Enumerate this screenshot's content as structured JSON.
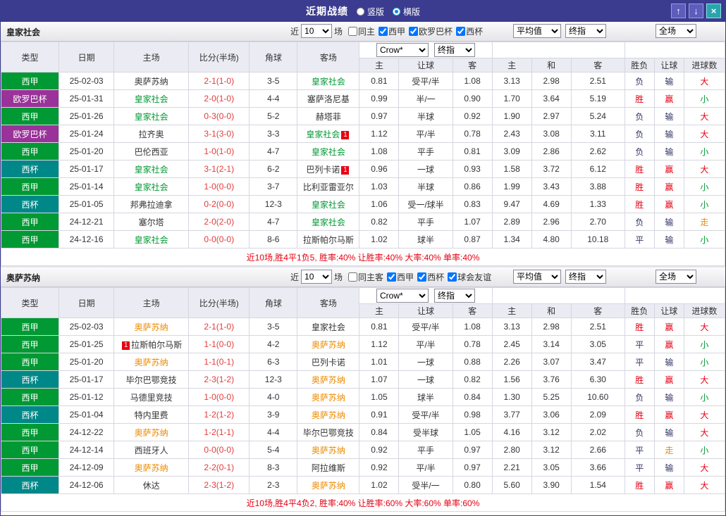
{
  "titlebar": {
    "title": "近期战绩",
    "radios": [
      {
        "label": "竖版",
        "selected": false
      },
      {
        "label": "横版",
        "selected": true
      }
    ],
    "up_icon": "↑",
    "down_icon": "↓",
    "close_icon": "×"
  },
  "columns": {
    "type": "类型",
    "date": "日期",
    "home": "主场",
    "score": "比分(半场)",
    "corner": "角球",
    "away": "客场",
    "asian": [
      "主",
      "让球",
      "客"
    ],
    "euro": [
      "主",
      "和",
      "客"
    ],
    "results": [
      "胜负",
      "让球",
      "进球数"
    ]
  },
  "filter_labels": {
    "near": "近",
    "games": "场"
  },
  "colors": {
    "league": {
      "西甲": "#009933",
      "欧罗巴杯": "#993399",
      "西杯": "#008888"
    },
    "outcome": {
      "胜": "#e60012",
      "负": "#333366",
      "平": "#333366",
      "赢": "#e60012",
      "输": "#333366",
      "走": "#e78c0a",
      "大": "#e60012",
      "小": "#009933"
    },
    "score": "#e33b3b",
    "badge": "#e60012"
  },
  "sections": [
    {
      "team": "皇家社会",
      "team_color": "#009933",
      "count": "10",
      "same_label": "同主",
      "leagues": [
        "西甲",
        "欧罗巴杯",
        "西杯"
      ],
      "selects": {
        "company": "Crow*",
        "final": "终指",
        "avg": "平均值",
        "avg_final": "终指",
        "scope": "全场"
      },
      "rows": [
        {
          "lg": "西甲",
          "date": "25-02-03",
          "home": "奥萨苏纳",
          "hh": false,
          "hb": "",
          "score": "2-1(1-0)",
          "cor": "3-5",
          "away": "皇家社会",
          "ah": true,
          "ab": "",
          "o1": "0.81",
          "hc": "受平/半",
          "o2": "1.08",
          "e1": "3.13",
          "e2": "2.98",
          "e3": "2.51",
          "r": "负",
          "hr": "输",
          "g": "大"
        },
        {
          "lg": "欧罗巴杯",
          "date": "25-01-31",
          "home": "皇家社会",
          "hh": true,
          "hb": "",
          "score": "2-0(1-0)",
          "cor": "4-4",
          "away": "塞萨洛尼基",
          "ah": false,
          "ab": "",
          "o1": "0.99",
          "hc": "半/一",
          "o2": "0.90",
          "e1": "1.70",
          "e2": "3.64",
          "e3": "5.19",
          "r": "胜",
          "hr": "赢",
          "g": "小"
        },
        {
          "lg": "西甲",
          "date": "25-01-26",
          "home": "皇家社会",
          "hh": true,
          "hb": "",
          "score": "0-3(0-0)",
          "cor": "5-2",
          "away": "赫塔菲",
          "ah": false,
          "ab": "",
          "o1": "0.97",
          "hc": "半球",
          "o2": "0.92",
          "e1": "1.90",
          "e2": "2.97",
          "e3": "5.24",
          "r": "负",
          "hr": "输",
          "g": "大"
        },
        {
          "lg": "欧罗巴杯",
          "date": "25-01-24",
          "home": "拉齐奥",
          "hh": false,
          "hb": "",
          "score": "3-1(3-0)",
          "cor": "3-3",
          "away": "皇家社会",
          "ah": true,
          "ab": "after",
          "o1": "1.12",
          "hc": "平/半",
          "o2": "0.78",
          "e1": "2.43",
          "e2": "3.08",
          "e3": "3.11",
          "r": "负",
          "hr": "输",
          "g": "大"
        },
        {
          "lg": "西甲",
          "date": "25-01-20",
          "home": "巴伦西亚",
          "hh": false,
          "hb": "",
          "score": "1-0(1-0)",
          "cor": "4-7",
          "away": "皇家社会",
          "ah": true,
          "ab": "",
          "o1": "1.08",
          "hc": "平手",
          "o2": "0.81",
          "e1": "3.09",
          "e2": "2.86",
          "e3": "2.62",
          "r": "负",
          "hr": "输",
          "g": "小"
        },
        {
          "lg": "西杯",
          "date": "25-01-17",
          "home": "皇家社会",
          "hh": true,
          "hb": "",
          "score": "3-1(2-1)",
          "cor": "6-2",
          "away": "巴列卡诺",
          "ah": false,
          "ab": "after",
          "o1": "0.96",
          "hc": "一球",
          "o2": "0.93",
          "e1": "1.58",
          "e2": "3.72",
          "e3": "6.12",
          "r": "胜",
          "hr": "赢",
          "g": "大"
        },
        {
          "lg": "西甲",
          "date": "25-01-14",
          "home": "皇家社会",
          "hh": true,
          "hb": "",
          "score": "1-0(0-0)",
          "cor": "3-7",
          "away": "比利亚雷亚尔",
          "ah": false,
          "ab": "",
          "o1": "1.03",
          "hc": "半球",
          "o2": "0.86",
          "e1": "1.99",
          "e2": "3.43",
          "e3": "3.88",
          "r": "胜",
          "hr": "赢",
          "g": "小"
        },
        {
          "lg": "西杯",
          "date": "25-01-05",
          "home": "邦弗拉迪拿",
          "hh": false,
          "hb": "",
          "score": "0-2(0-0)",
          "cor": "12-3",
          "away": "皇家社会",
          "ah": true,
          "ab": "",
          "o1": "1.06",
          "hc": "受一/球半",
          "o2": "0.83",
          "e1": "9.47",
          "e2": "4.69",
          "e3": "1.33",
          "r": "胜",
          "hr": "赢",
          "g": "小"
        },
        {
          "lg": "西甲",
          "date": "24-12-21",
          "home": "塞尔塔",
          "hh": false,
          "hb": "",
          "score": "2-0(2-0)",
          "cor": "4-7",
          "away": "皇家社会",
          "ah": true,
          "ab": "",
          "o1": "0.82",
          "hc": "平手",
          "o2": "1.07",
          "e1": "2.89",
          "e2": "2.96",
          "e3": "2.70",
          "r": "负",
          "hr": "输",
          "g": "走"
        },
        {
          "lg": "西甲",
          "date": "24-12-16",
          "home": "皇家社会",
          "hh": true,
          "hb": "",
          "score": "0-0(0-0)",
          "cor": "8-6",
          "away": "拉斯帕尔马斯",
          "ah": false,
          "ab": "",
          "o1": "1.02",
          "hc": "球半",
          "o2": "0.87",
          "e1": "1.34",
          "e2": "4.80",
          "e3": "10.18",
          "r": "平",
          "hr": "输",
          "g": "小"
        }
      ],
      "summary": "近10场,胜4平1负5, 胜率:40% 让胜率:40% 大率:40% 单率:40%"
    },
    {
      "team": "奥萨苏纳",
      "team_color": "#ec8a00",
      "count": "10",
      "same_label": "同主客",
      "leagues": [
        "西甲",
        "西杯",
        "球会友谊"
      ],
      "selects": {
        "company": "Crow*",
        "final": "终指",
        "avg": "平均值",
        "avg_final": "终指",
        "scope": "全场"
      },
      "rows": [
        {
          "lg": "西甲",
          "date": "25-02-03",
          "home": "奥萨苏纳",
          "hh": true,
          "hb": "",
          "score": "2-1(1-0)",
          "cor": "3-5",
          "away": "皇家社会",
          "ah": false,
          "ab": "",
          "o1": "0.81",
          "hc": "受平/半",
          "o2": "1.08",
          "e1": "3.13",
          "e2": "2.98",
          "e3": "2.51",
          "r": "胜",
          "hr": "赢",
          "g": "大"
        },
        {
          "lg": "西甲",
          "date": "25-01-25",
          "home": "拉斯帕尔马斯",
          "hh": false,
          "hb": "before",
          "score": "1-1(0-0)",
          "cor": "4-2",
          "away": "奥萨苏纳",
          "ah": true,
          "ab": "",
          "o1": "1.12",
          "hc": "平/半",
          "o2": "0.78",
          "e1": "2.45",
          "e2": "3.14",
          "e3": "3.05",
          "r": "平",
          "hr": "赢",
          "g": "小"
        },
        {
          "lg": "西甲",
          "date": "25-01-20",
          "home": "奥萨苏纳",
          "hh": true,
          "hb": "",
          "score": "1-1(0-1)",
          "cor": "6-3",
          "away": "巴列卡诺",
          "ah": false,
          "ab": "",
          "o1": "1.01",
          "hc": "一球",
          "o2": "0.88",
          "e1": "2.26",
          "e2": "3.07",
          "e3": "3.47",
          "r": "平",
          "hr": "输",
          "g": "小"
        },
        {
          "lg": "西杯",
          "date": "25-01-17",
          "home": "毕尔巴鄂竞技",
          "hh": false,
          "hb": "",
          "score": "2-3(1-2)",
          "cor": "12-3",
          "away": "奥萨苏纳",
          "ah": true,
          "ab": "",
          "o1": "1.07",
          "hc": "一球",
          "o2": "0.82",
          "e1": "1.56",
          "e2": "3.76",
          "e3": "6.30",
          "r": "胜",
          "hr": "赢",
          "g": "大"
        },
        {
          "lg": "西甲",
          "date": "25-01-12",
          "home": "马德里竞技",
          "hh": false,
          "hb": "",
          "score": "1-0(0-0)",
          "cor": "4-0",
          "away": "奥萨苏纳",
          "ah": true,
          "ab": "",
          "o1": "1.05",
          "hc": "球半",
          "o2": "0.84",
          "e1": "1.30",
          "e2": "5.25",
          "e3": "10.60",
          "r": "负",
          "hr": "输",
          "g": "小"
        },
        {
          "lg": "西杯",
          "date": "25-01-04",
          "home": "特内里费",
          "hh": false,
          "hb": "",
          "score": "1-2(1-2)",
          "cor": "3-9",
          "away": "奥萨苏纳",
          "ah": true,
          "ab": "",
          "o1": "0.91",
          "hc": "受平/半",
          "o2": "0.98",
          "e1": "3.77",
          "e2": "3.06",
          "e3": "2.09",
          "r": "胜",
          "hr": "赢",
          "g": "大"
        },
        {
          "lg": "西甲",
          "date": "24-12-22",
          "home": "奥萨苏纳",
          "hh": true,
          "hb": "",
          "score": "1-2(1-1)",
          "cor": "4-4",
          "away": "毕尔巴鄂竞技",
          "ah": false,
          "ab": "",
          "o1": "0.84",
          "hc": "受半球",
          "o2": "1.05",
          "e1": "4.16",
          "e2": "3.12",
          "e3": "2.02",
          "r": "负",
          "hr": "输",
          "g": "大"
        },
        {
          "lg": "西甲",
          "date": "24-12-14",
          "home": "西班牙人",
          "hh": false,
          "hb": "",
          "score": "0-0(0-0)",
          "cor": "5-4",
          "away": "奥萨苏纳",
          "ah": true,
          "ab": "",
          "o1": "0.92",
          "hc": "平手",
          "o2": "0.97",
          "e1": "2.80",
          "e2": "3.12",
          "e3": "2.66",
          "r": "平",
          "hr": "走",
          "g": "小"
        },
        {
          "lg": "西甲",
          "date": "24-12-09",
          "home": "奥萨苏纳",
          "hh": true,
          "hb": "",
          "score": "2-2(0-1)",
          "cor": "8-3",
          "away": "阿拉维斯",
          "ah": false,
          "ab": "",
          "o1": "0.92",
          "hc": "平/半",
          "o2": "0.97",
          "e1": "2.21",
          "e2": "3.05",
          "e3": "3.66",
          "r": "平",
          "hr": "输",
          "g": "大"
        },
        {
          "lg": "西杯",
          "date": "24-12-06",
          "home": "休达",
          "hh": false,
          "hb": "",
          "score": "2-3(1-2)",
          "cor": "2-3",
          "away": "奥萨苏纳",
          "ah": true,
          "ab": "",
          "o1": "1.02",
          "hc": "受半/一",
          "o2": "0.80",
          "e1": "5.60",
          "e2": "3.90",
          "e3": "1.54",
          "r": "胜",
          "hr": "赢",
          "g": "大"
        }
      ],
      "summary": "近10场,胜4平4负2, 胜率:40% 让胜率:60% 大率:60% 单率:60%"
    }
  ]
}
